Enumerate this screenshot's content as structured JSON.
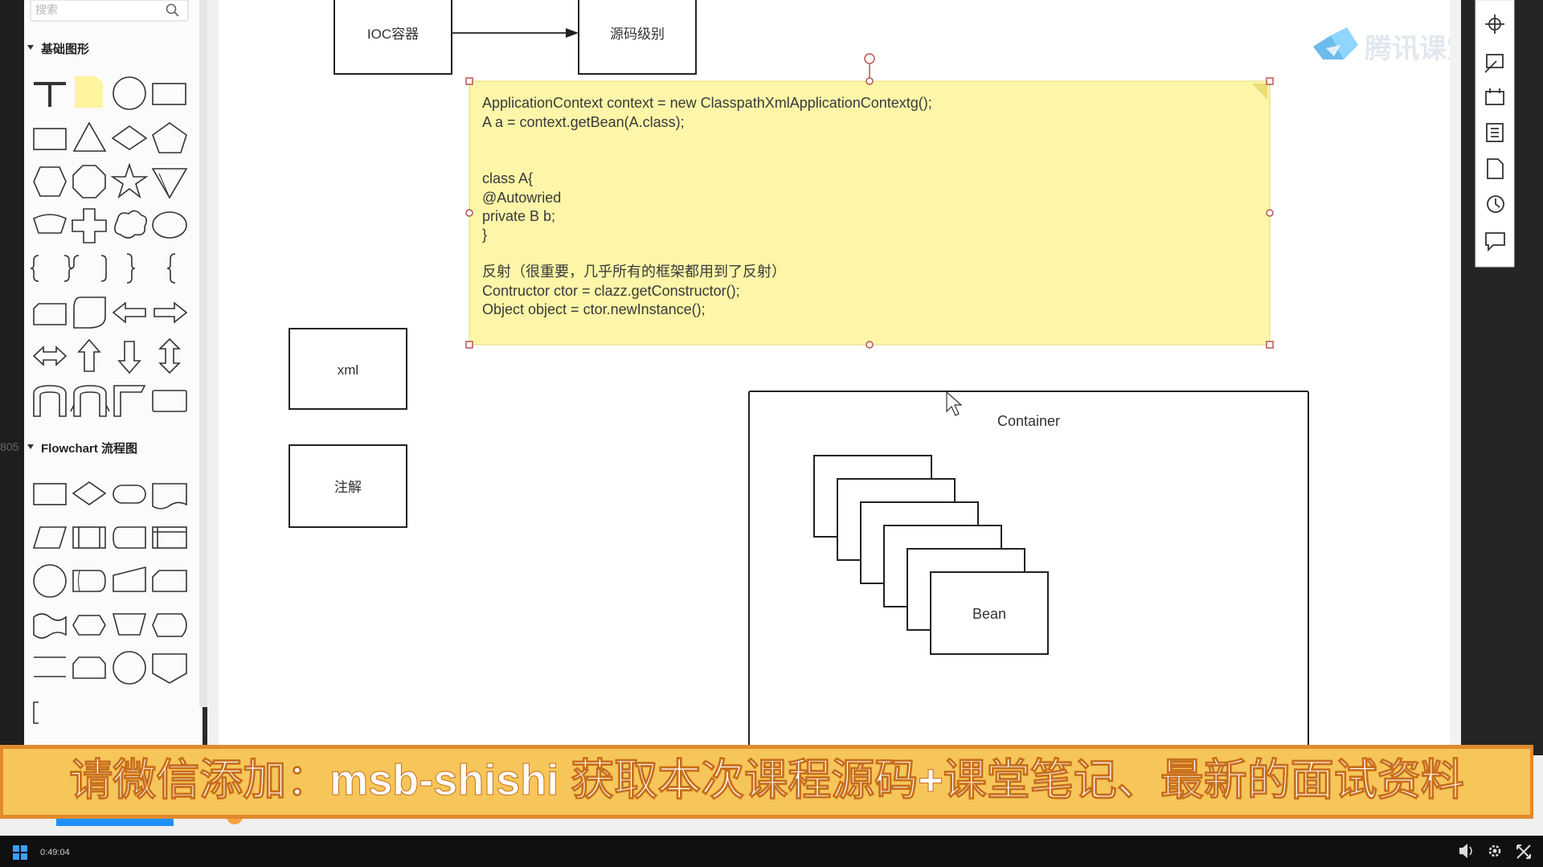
{
  "sidebar": {
    "search_placeholder": "搜索",
    "section_basic": "基础图形",
    "section_flowchart": "Flowchart 流程图",
    "side_number": "805"
  },
  "canvas": {
    "box_ioc": "IOC容器",
    "box_source": "源码级别",
    "box_xml": "xml",
    "box_annotation": "注解",
    "container_label": "Container",
    "bean_label": "Bean",
    "note_lines": [
      "ApplicationContext context = new ClasspathXmlApplicationContextg();",
      "A a  = context.getBean(A.class);",
      "",
      "",
      "class A{",
      "@Autowried",
      "private B b;",
      "}",
      "",
      "反射（很重要，几乎所有的框架都用到了反射）",
      "Contructor ctor = clazz.getConstructor();",
      "Object object = ctor.newInstance();"
    ]
  },
  "watermark": "腾讯课堂",
  "banner": "请微信添加：msb-shishi 获取本次课程源码+课堂笔记、最新的面试资料",
  "taskbar": {
    "time": "0:49:04"
  },
  "colors": {
    "note_fill": "#fdf6a8",
    "banner_fill": "#f6c65a",
    "banner_border": "#e2892e",
    "watermark_blue": "#3aa6e6"
  }
}
